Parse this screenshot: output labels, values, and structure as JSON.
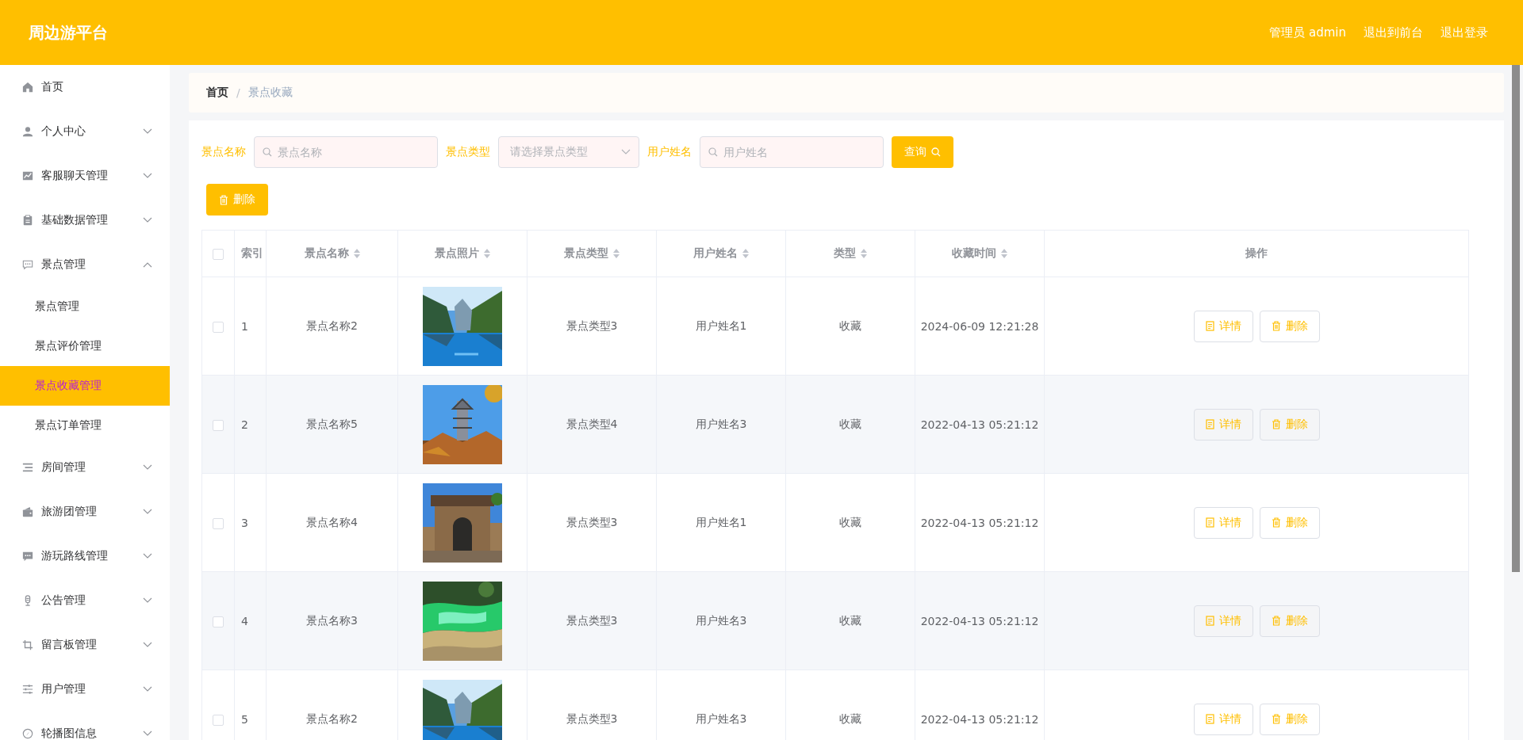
{
  "header": {
    "title": "周边游平台",
    "links": [
      "管理员 admin",
      "退出到前台",
      "退出登录"
    ]
  },
  "sidebar": {
    "items": [
      {
        "label": "首页",
        "kind": "link"
      },
      {
        "label": "个人中心",
        "kind": "menu",
        "expanded": false
      },
      {
        "label": "客服聊天管理",
        "kind": "menu",
        "expanded": false
      },
      {
        "label": "基础数据管理",
        "kind": "menu",
        "expanded": false
      },
      {
        "label": "景点管理",
        "kind": "menu",
        "expanded": true,
        "children": [
          {
            "label": "景点管理",
            "selected": false
          },
          {
            "label": "景点评价管理",
            "selected": false
          },
          {
            "label": "景点收藏管理",
            "selected": true
          },
          {
            "label": "景点订单管理",
            "selected": false
          }
        ]
      },
      {
        "label": "房间管理",
        "kind": "menu",
        "expanded": false
      },
      {
        "label": "旅游团管理",
        "kind": "menu",
        "expanded": false
      },
      {
        "label": "游玩路线管理",
        "kind": "menu",
        "expanded": false
      },
      {
        "label": "公告管理",
        "kind": "menu",
        "expanded": false
      },
      {
        "label": "留言板管理",
        "kind": "menu",
        "expanded": false
      },
      {
        "label": "用户管理",
        "kind": "menu",
        "expanded": false
      },
      {
        "label": "轮播图信息",
        "kind": "menu",
        "expanded": false
      }
    ]
  },
  "breadcrumb": {
    "separator": "/",
    "items": [
      "首页",
      "景点收藏"
    ]
  },
  "filters": [
    {
      "label": "景点名称",
      "kind": "text",
      "placeholder": "景点名称"
    },
    {
      "label": "景点类型",
      "kind": "select",
      "placeholder": "请选择景点类型"
    },
    {
      "label": "用户姓名",
      "kind": "text",
      "placeholder": "用户姓名"
    }
  ],
  "search_button": "查询",
  "delete_button": "删除",
  "table": {
    "select_all": {
      "checked": false
    },
    "columns": [
      {
        "label": "索引",
        "sortable": false
      },
      {
        "label": "景点名称",
        "sortable": true
      },
      {
        "label": "景点照片",
        "sortable": true
      },
      {
        "label": "景点类型",
        "sortable": true
      },
      {
        "label": "用户姓名",
        "sortable": true
      },
      {
        "label": "类型",
        "sortable": true
      },
      {
        "label": "收藏时间",
        "sortable": true
      },
      {
        "label": "操作",
        "sortable": false
      }
    ],
    "rows": [
      {
        "checked": false,
        "index": "1",
        "name": "景点名称2",
        "type": "景点类型3",
        "user": "用户姓名1",
        "category": "收藏",
        "time": "2024-06-09 12:21:28",
        "actions": [
          "详情",
          "删除"
        ]
      },
      {
        "checked": false,
        "index": "2",
        "name": "景点名称5",
        "type": "景点类型4",
        "user": "用户姓名3",
        "category": "收藏",
        "time": "2022-04-13 05:21:12",
        "actions": [
          "详情",
          "删除"
        ]
      },
      {
        "checked": false,
        "index": "3",
        "name": "景点名称4",
        "type": "景点类型3",
        "user": "用户姓名1",
        "category": "收藏",
        "time": "2022-04-13 05:21:12",
        "actions": [
          "详情",
          "删除"
        ]
      },
      {
        "checked": false,
        "index": "4",
        "name": "景点名称3",
        "type": "景点类型3",
        "user": "用户姓名3",
        "category": "收藏",
        "time": "2022-04-13 05:21:12",
        "actions": [
          "详情",
          "删除"
        ]
      },
      {
        "checked": false,
        "index": "5",
        "name": "景点名称2",
        "type": "景点类型3",
        "user": "用户姓名3",
        "category": "收藏",
        "time": "2022-04-13 05:21:12",
        "actions": [
          "详情",
          "删除"
        ]
      }
    ]
  }
}
